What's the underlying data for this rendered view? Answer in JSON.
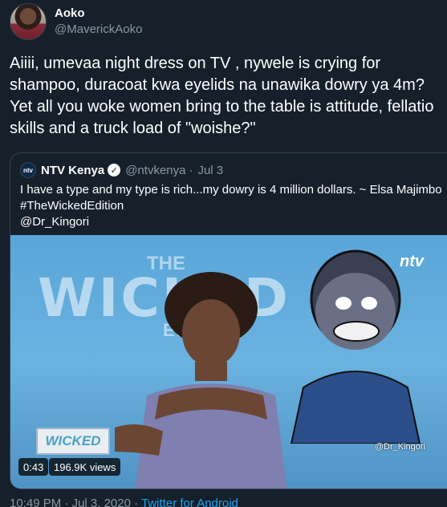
{
  "author": {
    "name": "Aoko",
    "handle": "@MaverickAoko"
  },
  "tweet": {
    "text": "Aiiii, umevaa night dress on TV , nywele is crying for shampoo, duracoat kwa eyelids na unawika dowry ya 4m? Yet all you woke women bring to the table is attitude, fellatio skills and a truck load of \"woishe?\""
  },
  "quote": {
    "avatar_label": "ntv",
    "name": "NTV Kenya",
    "handle": "@ntvkenya",
    "separator": "·",
    "date": "Jul 3",
    "lines": [
      "I have a type and my type is rich...my dowry is 4 million dollars. ~ Elsa Majimbo",
      "#TheWickedEdition",
      " @Dr_Kingori"
    ],
    "video": {
      "overlay_the": "THE",
      "overlay_title": "WICKED",
      "overlay_edition": "EDITION",
      "logo": "ntv",
      "badge": "WICKED",
      "credit": "@Dr_Kingori",
      "duration": "0:43",
      "views": "196.9K views"
    }
  },
  "footer": {
    "time": "10:49 PM",
    "separator1": " · ",
    "date": "Jul 3, 2020",
    "separator2": " · ",
    "source": "Twitter for Android"
  }
}
